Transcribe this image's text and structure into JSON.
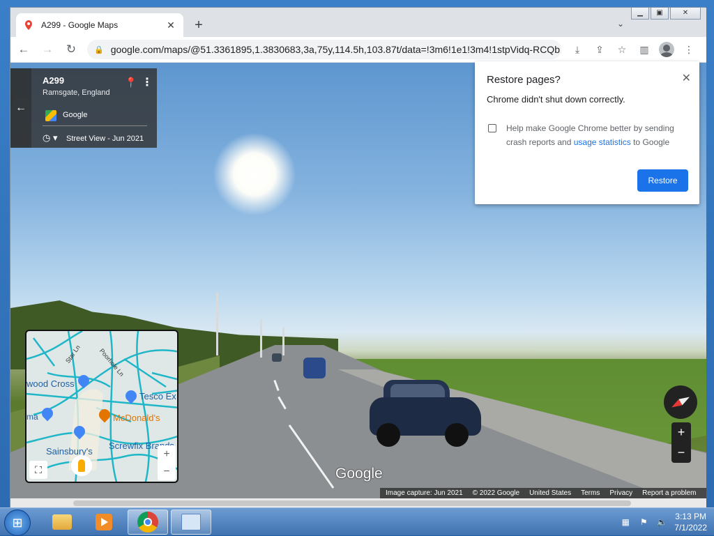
{
  "browser": {
    "tab_title": "A299 - Google Maps",
    "url": "google.com/maps/@51.3361895,1.3830683,3a,75y,114.5h,103.87t/data=!3m6!1e1!3m4!1stpVidq-RCQb...",
    "icons": {
      "back": "arrow-left-icon",
      "forward": "arrow-right-icon",
      "reload": "reload-icon",
      "lock": "lock-icon"
    }
  },
  "infocard": {
    "name": "A299",
    "location": "Ramsgate, England",
    "provider": "Google",
    "street_view": "Street View - Jun 2021"
  },
  "minimap": {
    "labels": {
      "star_ln": "Star Ln",
      "poorhole_ln": "Poorhole Ln",
      "wood_cross": "wood Cross",
      "tesco": "Tesco Ex",
      "mcdonalds": "McDonald's",
      "ma": "ma",
      "screwfix": "Screwfix Brands",
      "sainsburys": "Sainsbury's"
    },
    "zoom_in": "+",
    "zoom_out": "−"
  },
  "streetview": {
    "logo": "Google",
    "zoom_in": "+",
    "zoom_out": "−",
    "footer": {
      "capture": "Image capture: Jun 2021",
      "copyright": "© 2022 Google",
      "region": "United States",
      "terms": "Terms",
      "privacy": "Privacy",
      "report": "Report a problem"
    }
  },
  "restore_dialog": {
    "title": "Restore pages?",
    "message": "Chrome didn't shut down correctly.",
    "checkbox_pre": "Help make Google Chrome better by sending crash reports and ",
    "checkbox_link": "usage statistics",
    "checkbox_post": " to Google",
    "button": "Restore"
  },
  "taskbar": {
    "time": "3:13 PM",
    "date": "7/1/2022"
  },
  "colors": {
    "accent": "#1a73e8",
    "taskbar": "#3f72b0"
  }
}
